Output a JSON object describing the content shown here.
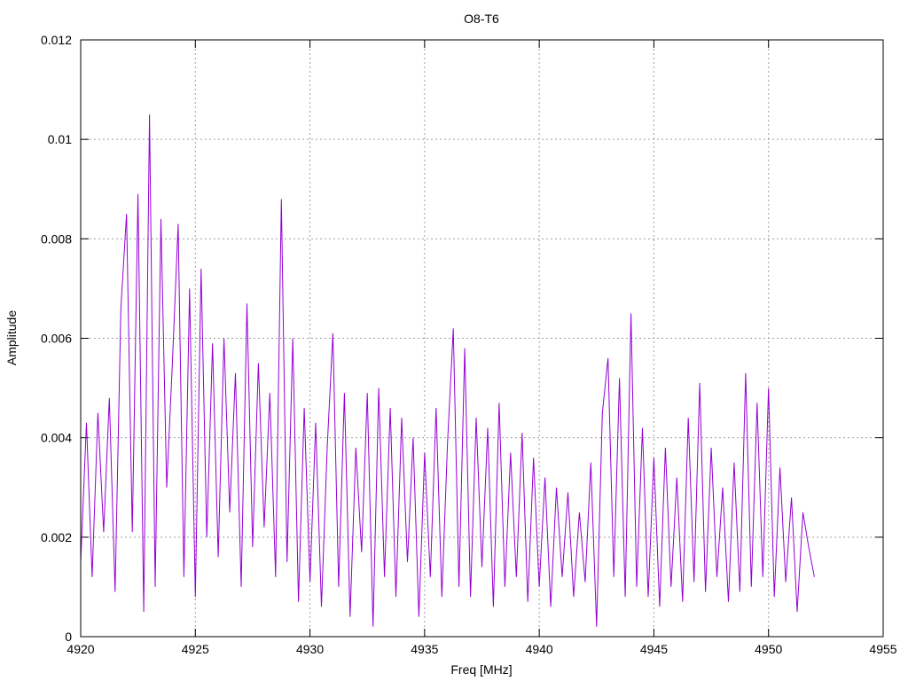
{
  "chart_data": {
    "type": "line",
    "title": "O8-T6",
    "xlabel": "Freq [MHz]",
    "ylabel": "Amplitude",
    "xlim": [
      4920,
      4955
    ],
    "ylim": [
      0,
      0.012
    ],
    "xticks": [
      "4920",
      "4925",
      "4930",
      "4935",
      "4940",
      "4945",
      "4950",
      "4955"
    ],
    "yticks": [
      "0",
      "0.002",
      "0.004",
      "0.006",
      "0.008",
      "0.01",
      "0.012"
    ],
    "grid": true,
    "color": "#9400d3",
    "series": [
      {
        "name": "O8-T6",
        "x_start": 4920,
        "x_step": 0.25,
        "values": [
          0.0015,
          0.0043,
          0.0012,
          0.0045,
          0.0021,
          0.0048,
          0.0009,
          0.0066,
          0.0085,
          0.0021,
          0.0089,
          0.0005,
          0.0105,
          0.001,
          0.0084,
          0.003,
          0.0055,
          0.0083,
          0.0012,
          0.007,
          0.0008,
          0.0074,
          0.002,
          0.0059,
          0.0016,
          0.006,
          0.0025,
          0.0053,
          0.001,
          0.0067,
          0.0018,
          0.0055,
          0.0022,
          0.0049,
          0.0012,
          0.0088,
          0.0015,
          0.006,
          0.0007,
          0.0046,
          0.0011,
          0.0043,
          0.0006,
          0.0038,
          0.0061,
          0.001,
          0.0049,
          0.0004,
          0.0038,
          0.0017,
          0.0049,
          0.0002,
          0.005,
          0.0012,
          0.0046,
          0.0008,
          0.0044,
          0.0015,
          0.004,
          0.0004,
          0.0037,
          0.0012,
          0.0046,
          0.0008,
          0.0039,
          0.0062,
          0.001,
          0.0058,
          0.0008,
          0.0044,
          0.0014,
          0.0042,
          0.0006,
          0.0047,
          0.001,
          0.0037,
          0.0012,
          0.0041,
          0.0007,
          0.0036,
          0.001,
          0.0032,
          0.0006,
          0.003,
          0.0012,
          0.0029,
          0.0008,
          0.0025,
          0.0011,
          0.0035,
          0.0002,
          0.0045,
          0.0056,
          0.0012,
          0.0052,
          0.0008,
          0.0065,
          0.001,
          0.0042,
          0.0008,
          0.0036,
          0.0006,
          0.0038,
          0.001,
          0.0032,
          0.0007,
          0.0044,
          0.0011,
          0.0051,
          0.0009,
          0.0038,
          0.0012,
          0.003,
          0.0007,
          0.0035,
          0.0009,
          0.0053,
          0.001,
          0.0047,
          0.0012,
          0.005,
          0.0008,
          0.0034,
          0.0011,
          0.0028,
          0.0005,
          0.0025,
          0.0018,
          0.0012
        ]
      }
    ]
  }
}
